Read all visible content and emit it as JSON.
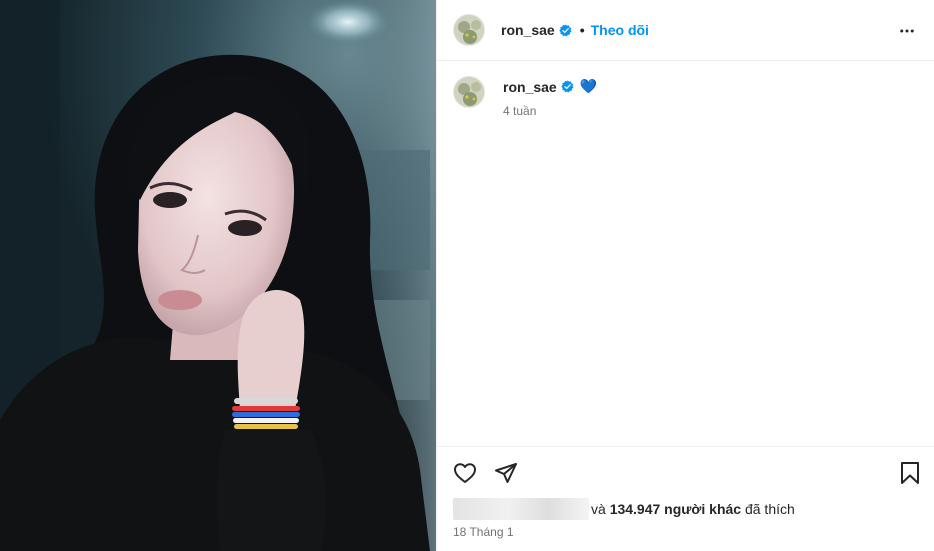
{
  "post": {
    "username": "ron_sae",
    "follow_label": "Theo dõi",
    "separator": "•",
    "caption_text": "💙",
    "caption_age": "4 tuần",
    "likes_prefix": "và",
    "likes_count": "134.947 người khác",
    "likes_suffix": "đã thích",
    "post_date": "18 Tháng 1"
  },
  "icons": {
    "verified": "verified-badge-icon",
    "more": "more-options-icon",
    "like": "heart-icon",
    "share": "paper-plane-icon",
    "save": "bookmark-icon"
  },
  "colors": {
    "follow": "#0095f6",
    "verified": "#0095f6",
    "muted": "#737373"
  }
}
